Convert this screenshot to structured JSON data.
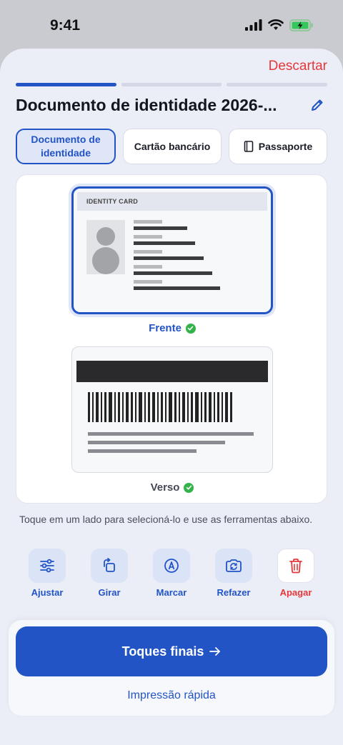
{
  "status": {
    "time": "9:41"
  },
  "header": {
    "discard_label": "Descartar",
    "progress": {
      "steps": 3,
      "current": 1
    },
    "title": "Documento de identidade 2026-..."
  },
  "tabs": [
    {
      "label": "Documento de identidade",
      "selected": true
    },
    {
      "label": "Cartão bancário",
      "selected": false
    },
    {
      "label": "Passaporte",
      "selected": false,
      "icon": "book-icon"
    }
  ],
  "preview": {
    "front": {
      "card_header": "IDENTITY CARD",
      "label": "Frente",
      "done": true
    },
    "back": {
      "label": "Verso",
      "done": true
    }
  },
  "hint": "Toque em um lado para selecioná-lo e use as ferramentas abaixo.",
  "tools": [
    {
      "label": "Ajustar",
      "icon": "sliders-icon"
    },
    {
      "label": "Girar",
      "icon": "rotate-icon"
    },
    {
      "label": "Marcar",
      "icon": "markup-pen-icon"
    },
    {
      "label": "Refazer",
      "icon": "retake-camera-icon"
    },
    {
      "label": "Apagar",
      "icon": "trash-icon"
    }
  ],
  "actions": {
    "primary_label": "Toques finais",
    "secondary_label": "Impressão rápida"
  },
  "colors": {
    "accent": "#2254c5",
    "danger": "#e5383b",
    "success": "#34b34a"
  }
}
